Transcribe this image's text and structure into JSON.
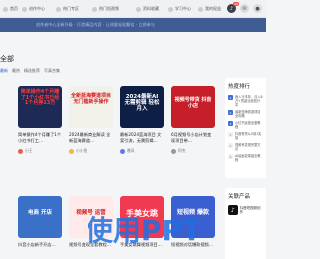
{
  "nav": {
    "items": [
      {
        "label": "首页"
      },
      {
        "label": "创作中心"
      },
      {
        "label": "热门专区"
      },
      {
        "label": "热门短视频"
      },
      {
        "label": "资料收藏"
      },
      {
        "label": "学习中心"
      },
      {
        "label": "我的权益"
      }
    ],
    "badge": "99"
  },
  "hero": {
    "text": "创作者中心全新升级 · 打造精品内容 · 让流量轻松翻倍 · 立即参与"
  },
  "page": {
    "title": "全部"
  },
  "filters": [
    "最新",
    "最热",
    "精选推荐",
    "写真合集"
  ],
  "cards": [
    {
      "overlay": "简单操作4个月赚了1个小红书已经1个月挣13万",
      "title": "简单操作4个月赚了1个小红书打工…",
      "author": "小王",
      "bg": "#1c2a55",
      "fg": "#ff3b3b"
    },
    {
      "overlay": "全新蓝海赛道项目 无门槛新手操作",
      "title": "2024最新商业解读 全新蓝海赛道…",
      "author": "小小鱼",
      "bg": "#f1f1ea",
      "fg": "#d42020"
    },
    {
      "overlay": "2024最新AI 无需剪辑 轻松月入",
      "title": "最新2024蓝海项目 文案引流，无需剪辑…",
      "author": "晚风",
      "bg": "#0d1f44",
      "fg": "#ffffff"
    },
    {
      "overlay": "视频号带货 抖音小店",
      "title": "6月视频号小店计划变现项目带…",
      "author": "阿杰",
      "bg": "#c61f2a",
      "fg": "#ffffff"
    },
    {
      "overlay": "电商 开店",
      "title": "抖音小店新手开店…",
      "author": "老王",
      "bg": "#3a70c8",
      "fg": "#ffffff"
    },
    {
      "overlay": "视频号 运营",
      "title": "视频号变现全套教程…",
      "author": "阿峰",
      "bg": "#ffe9e9",
      "fg": "#cc2222"
    },
    {
      "overlay": "手美女跳",
      "title": "手美女跳舞视频项目…",
      "author": "小美",
      "bg": "#ef3a52",
      "fg": "#ffffff"
    },
    {
      "overlay": "短视频 爆款",
      "title": "短视频对话爆款视频…",
      "author": "小李",
      "bg": "#3a5fd0",
      "fg": "#ffffff"
    }
  ],
  "hot": {
    "title": "热度排行",
    "items": [
      "我入行半年，月入8万+的副业经验分享",
      "最新蓝海赛道项目全攻略",
      "小红书运营全套教程",
      "抖音带货从0到1实操",
      "视频号变现完整方法",
      "AI绘画变现副业教程"
    ]
  },
  "related": {
    "title": "关联产品",
    "product": {
      "name": "抖音短视频创作",
      "icon": "tiktok-icon"
    }
  },
  "watermark": {
    "text": "使用PPT"
  }
}
